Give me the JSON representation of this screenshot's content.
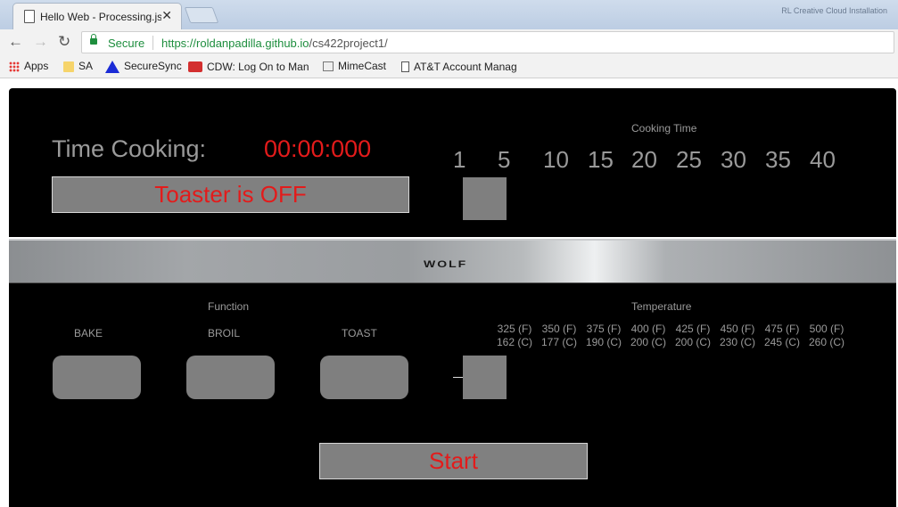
{
  "browser": {
    "tab_title": "Hello Web - Processing.js",
    "profile_hint": "RL Creative Cloud Installation",
    "secure_label": "Secure",
    "url_base": "https://roldanpadilla.github.io",
    "url_path": "/cs422project1/",
    "bookmarks": [
      {
        "label": "Apps",
        "icon": "apps-grid-icon"
      },
      {
        "label": "SA",
        "icon": "folder-icon"
      },
      {
        "label": "SecureSync",
        "icon": "triangle-icon"
      },
      {
        "label": "CDW: Log On to Man",
        "icon": "cdw-icon"
      },
      {
        "label": "MimeCast",
        "icon": "mimecast-icon"
      },
      {
        "label": "AT&T Account Manag",
        "icon": "page-icon"
      }
    ]
  },
  "oven": {
    "time_label": "Time Cooking:",
    "time_value": "00:00:000",
    "status_text": "Toaster is OFF",
    "cooking_time_label": "Cooking Time",
    "minutes": [
      "1",
      "5",
      "10",
      "15",
      "20",
      "25",
      "30",
      "35",
      "40"
    ],
    "selected_minute": "5",
    "brand": "WOLF",
    "function_label": "Function",
    "functions": [
      "BAKE",
      "BROIL",
      "TOAST"
    ],
    "temperature_label": "Temperature",
    "temperatures": [
      {
        "f": "325 (F)",
        "c": "162 (C)"
      },
      {
        "f": "350 (F)",
        "c": "177 (C)"
      },
      {
        "f": "375 (F)",
        "c": "190 (C)"
      },
      {
        "f": "400 (F)",
        "c": "200 (C)"
      },
      {
        "f": "425 (F)",
        "c": "200 (C)"
      },
      {
        "f": "450 (F)",
        "c": "230 (C)"
      },
      {
        "f": "475 (F)",
        "c": "245 (C)"
      },
      {
        "f": "500 (F)",
        "c": "260 (C)"
      }
    ],
    "start_label": "Start",
    "colors": {
      "accent_red": "#e31b1b",
      "control_gray": "#7f7f7f",
      "label_gray": "#9a9a9a",
      "panel": "#000000"
    }
  }
}
